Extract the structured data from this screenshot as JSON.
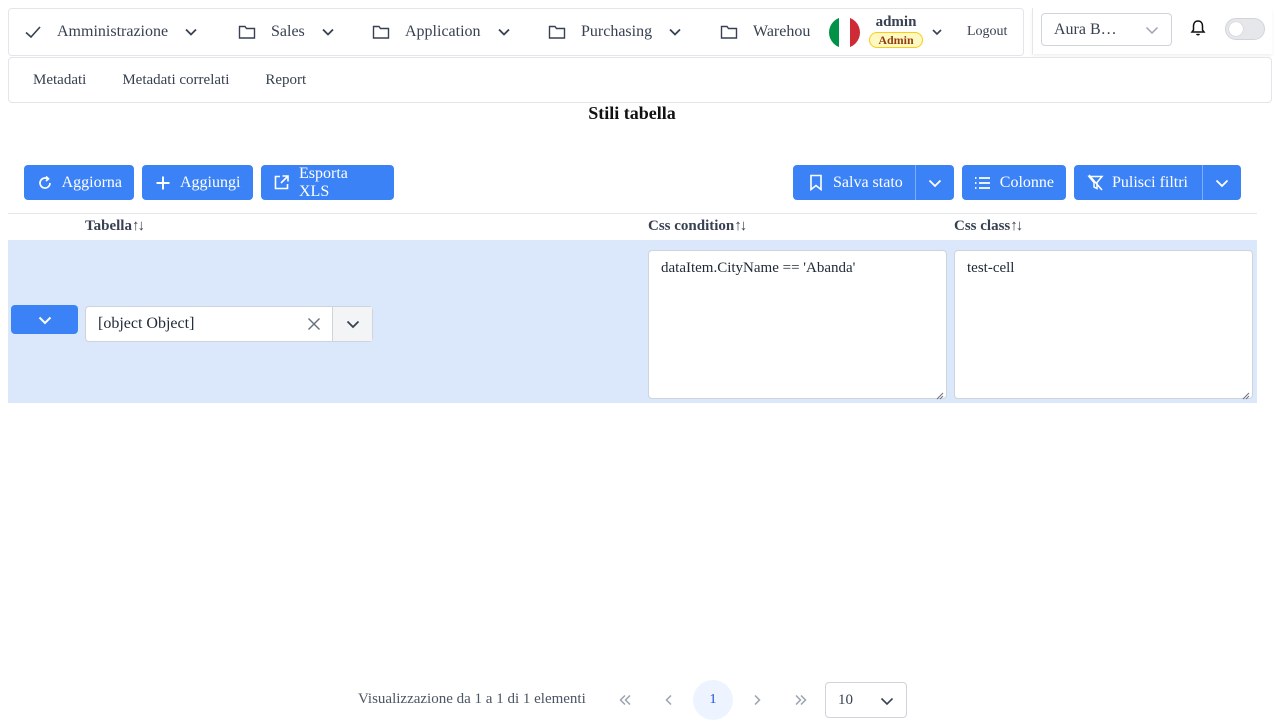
{
  "nav": {
    "items": [
      {
        "label": "Amministrazione",
        "icon": "check-icon"
      },
      {
        "label": "Sales",
        "icon": "folder-icon"
      },
      {
        "label": "Application",
        "icon": "folder-icon"
      },
      {
        "label": "Purchasing",
        "icon": "folder-icon"
      },
      {
        "label": "Warehou",
        "icon": "folder-icon"
      }
    ],
    "user_name": "admin",
    "user_role": "Admin",
    "logout_label": "Logout",
    "company": "Aura B…",
    "flag_colors": [
      "#009246",
      "#ffffff",
      "#ce2b37"
    ]
  },
  "tabs": [
    "Metadati",
    "Metadati correlati",
    "Report"
  ],
  "page_title": "Stili tabella",
  "toolbar": {
    "refresh_label": "Aggiorna",
    "add_label": "Aggiungi",
    "export_label": "Esporta XLS",
    "save_state_label": "Salva stato",
    "columns_label": "Colonne",
    "clear_filters_label": "Pulisci filtri",
    "accent": "#3b82f6"
  },
  "table": {
    "columns": [
      "Tabella",
      "Css condition",
      "Css class"
    ],
    "sort_glyph": "↑↓",
    "rows": [
      {
        "tabella": "[object Object]",
        "css_condition": "dataItem.CityName == 'Abanda'",
        "css_class": "test-cell"
      }
    ],
    "selected_row_color": "#dbe7fb"
  },
  "pager": {
    "info": "Visualizzazione da 1 a 1 di 1 elementi",
    "current_page": "1",
    "page_size": "10"
  }
}
